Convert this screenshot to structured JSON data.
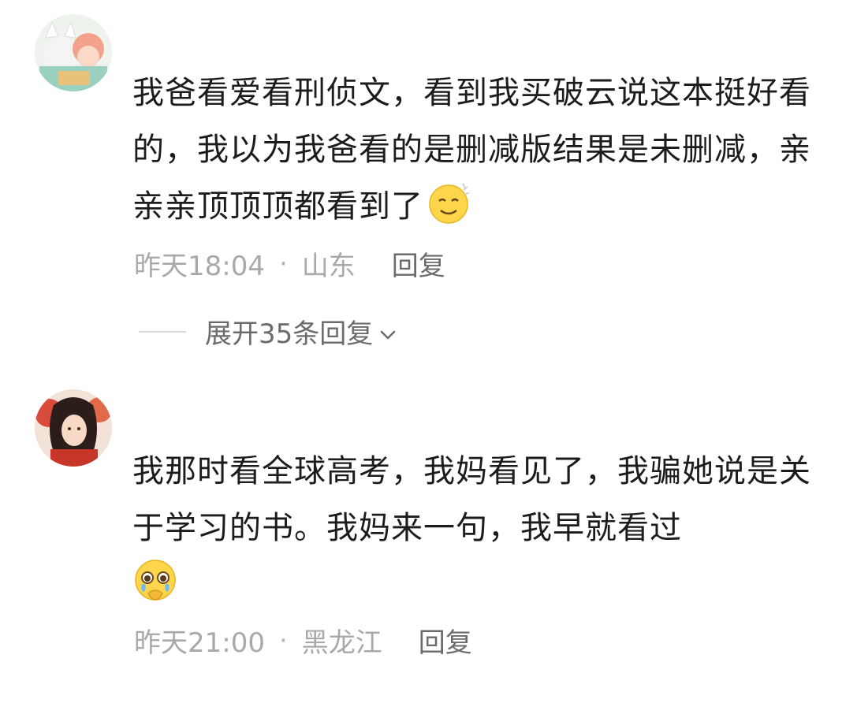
{
  "comments": [
    {
      "text": "我爸看爱看刑侦文，看到我买破云说这本挺好看的，我以为我爸看的是删减版结果是未删减，亲亲亲顶顶顶都看到了",
      "emoji": "smiling-sweat-face-icon",
      "time": "昨天18:04",
      "separator": "·",
      "location": "山东",
      "reply_label": "回复"
    },
    {
      "text": "我那时看全球高考，我妈看见了，我骗她说是关于学习的书。我妈来一句，我早就看过",
      "emoji": "pleading-crying-face-icon",
      "time": "昨天21:00",
      "separator": "·",
      "location": "黑龙江",
      "reply_label": "回复"
    }
  ],
  "expand_replies": {
    "label": "展开35条回复"
  },
  "colors": {
    "text": "#1c1c1c",
    "meta": "#a9a9a9",
    "reply": "#6b6b6b",
    "emoji_yellow": "#ffd54a"
  }
}
